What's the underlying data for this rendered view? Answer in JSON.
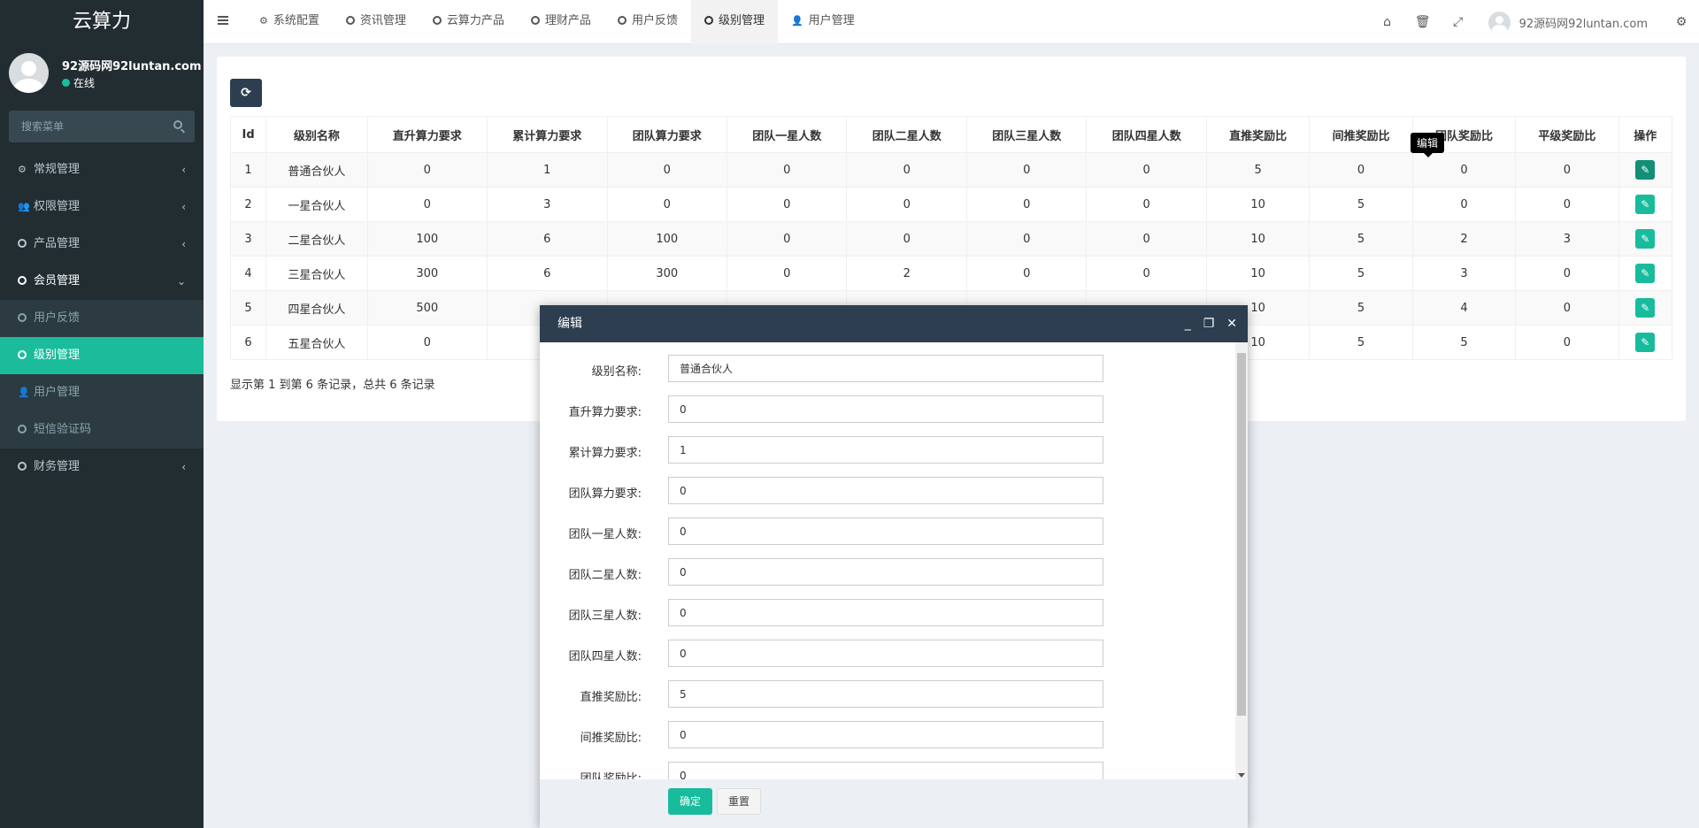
{
  "app": {
    "title": "云算力"
  },
  "user": {
    "name": "92源码网92luntan.com",
    "status": "在线"
  },
  "search": {
    "placeholder": "搜索菜单"
  },
  "sidebar": {
    "items": [
      {
        "label": "常规管理",
        "icon": "cogs-icon"
      },
      {
        "label": "权限管理",
        "icon": "users-icon"
      },
      {
        "label": "产品管理",
        "icon": "circle-icon"
      },
      {
        "label": "会员管理",
        "icon": "circle-icon"
      }
    ],
    "sub_items": [
      {
        "label": "用户反馈",
        "icon": "circle-icon"
      },
      {
        "label": "级别管理",
        "icon": "circle-icon"
      },
      {
        "label": "用户管理",
        "icon": "user-icon"
      },
      {
        "label": "短信验证码",
        "icon": "circle-icon"
      }
    ],
    "last_item": {
      "label": "财务管理",
      "icon": "circle-icon"
    }
  },
  "topnav": {
    "tabs": [
      {
        "label": "系统配置",
        "icon": "gear-icon"
      },
      {
        "label": "资讯管理",
        "icon": "circle-icon"
      },
      {
        "label": "云算力产品",
        "icon": "circle-icon"
      },
      {
        "label": "理财产品",
        "icon": "circle-icon"
      },
      {
        "label": "用户反馈",
        "icon": "circle-icon"
      },
      {
        "label": "级别管理",
        "icon": "circle-icon"
      },
      {
        "label": "用户管理",
        "icon": "user-icon"
      }
    ],
    "active_tab": "级别管理",
    "user_label": "92源码网92luntan.com"
  },
  "table": {
    "columns": [
      "Id",
      "级别名称",
      "直升算力要求",
      "累计算力要求",
      "团队算力要求",
      "团队一星人数",
      "团队二星人数",
      "团队三星人数",
      "团队四星人数",
      "直推奖励比",
      "间推奖励比",
      "团队奖励比",
      "平级奖励比",
      "操作"
    ],
    "rows": [
      [
        "1",
        "普通合伙人",
        "0",
        "1",
        "0",
        "0",
        "0",
        "0",
        "0",
        "5",
        "0",
        "0",
        "0"
      ],
      [
        "2",
        "一星合伙人",
        "0",
        "3",
        "0",
        "0",
        "0",
        "0",
        "0",
        "10",
        "5",
        "0",
        "0"
      ],
      [
        "3",
        "二星合伙人",
        "100",
        "6",
        "100",
        "0",
        "0",
        "0",
        "0",
        "10",
        "5",
        "2",
        "3"
      ],
      [
        "4",
        "三星合伙人",
        "300",
        "6",
        "300",
        "0",
        "2",
        "0",
        "0",
        "10",
        "5",
        "3",
        "0"
      ],
      [
        "5",
        "四星合伙人",
        "500",
        "",
        "",
        "",
        "",
        "",
        "",
        "10",
        "5",
        "4",
        "0"
      ],
      [
        "6",
        "五星合伙人",
        "0",
        "",
        "",
        "",
        "",
        "",
        "",
        "10",
        "5",
        "5",
        "0"
      ]
    ],
    "tooltip": "编辑",
    "page_info": "显示第 1 到第 6 条记录，总共 6 条记录"
  },
  "dialog": {
    "title": "编辑",
    "fields": [
      {
        "label": "级别名称:",
        "value": "普通合伙人"
      },
      {
        "label": "直升算力要求:",
        "value": "0"
      },
      {
        "label": "累计算力要求:",
        "value": "1"
      },
      {
        "label": "团队算力要求:",
        "value": "0"
      },
      {
        "label": "团队一星人数:",
        "value": "0"
      },
      {
        "label": "团队二星人数:",
        "value": "0"
      },
      {
        "label": "团队三星人数:",
        "value": "0"
      },
      {
        "label": "团队四星人数:",
        "value": "0"
      },
      {
        "label": "直推奖励比:",
        "value": "5"
      },
      {
        "label": "间推奖励比:",
        "value": "0"
      },
      {
        "label": "团队奖励比:",
        "value": "0"
      }
    ],
    "ok_label": "确定",
    "reset_label": "重置"
  },
  "colors": {
    "accent": "#18bc9c",
    "sidebar": "#222d32",
    "header": "#2c3e50"
  }
}
